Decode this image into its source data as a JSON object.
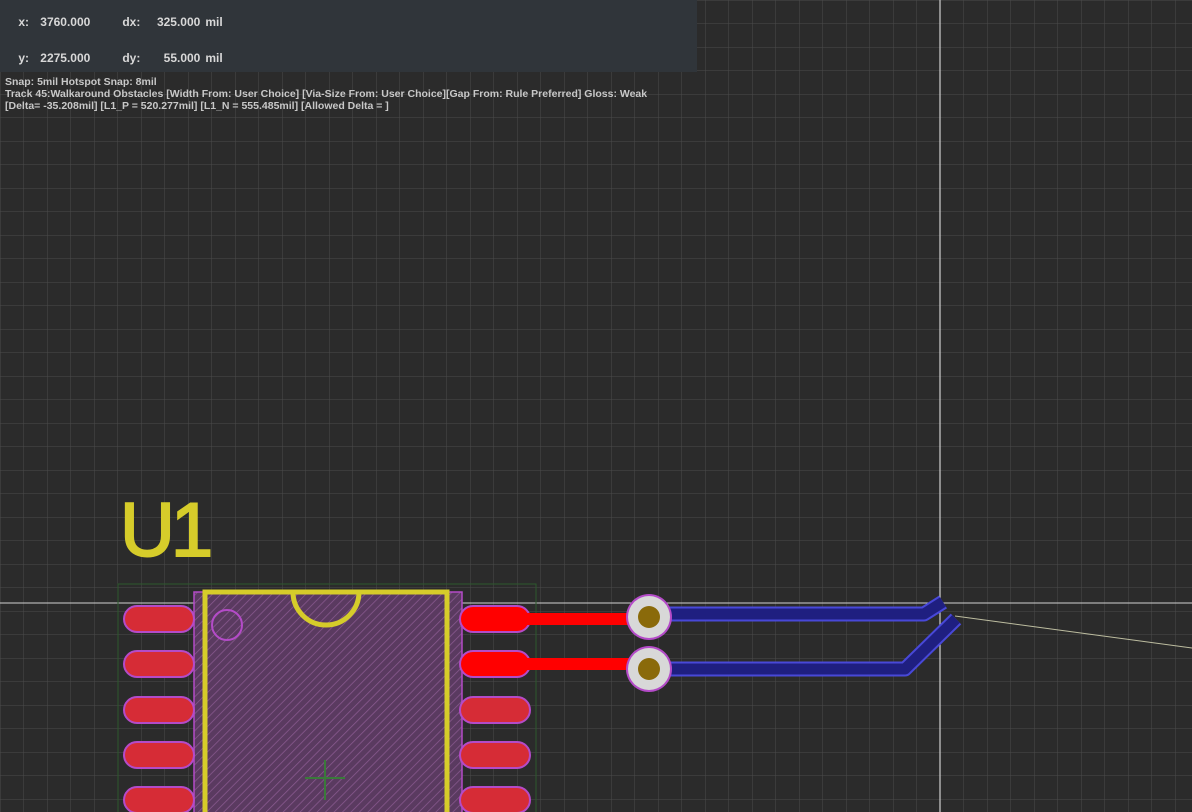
{
  "hud": {
    "x_label": "x:",
    "x_value": "3760.000",
    "dx_label": "dx:",
    "dx_value": "325.000",
    "dx_unit": "mil",
    "y_label": "y:",
    "y_value": "2275.000",
    "dy_label": "dy:",
    "dy_value": "55.000",
    "dy_unit": "mil",
    "snap": "Snap: 5mil Hotspot Snap: 8mil",
    "track": "Track 45:Walkaround Obstacles [Width From: User Choice] [Via-Size From: User Choice][Gap From: Rule Preferred] Gloss: Weak",
    "delta": "[Delta= -35.208mil] [L1_P = 520.277mil] [L1_N = 555.485mil] [Allowed Delta = ]"
  },
  "component": {
    "designator": "U1"
  },
  "colors": {
    "background": "#2b2b2b",
    "grid": "#4a4a4a",
    "silkscreen": "#d6cc2a",
    "pad": "#d62c36",
    "pad_outline": "#b44bc8",
    "top_track": "#ff0000",
    "bottom_track": "#2a2aa8",
    "via_ring": "#d8d8d8",
    "via_hole": "#8a6a0a",
    "crosshair": "#d0d0d0"
  },
  "icons": {
    "via": "via-icon",
    "origin": "component-origin-icon",
    "pin1": "pin1-marker-icon"
  }
}
